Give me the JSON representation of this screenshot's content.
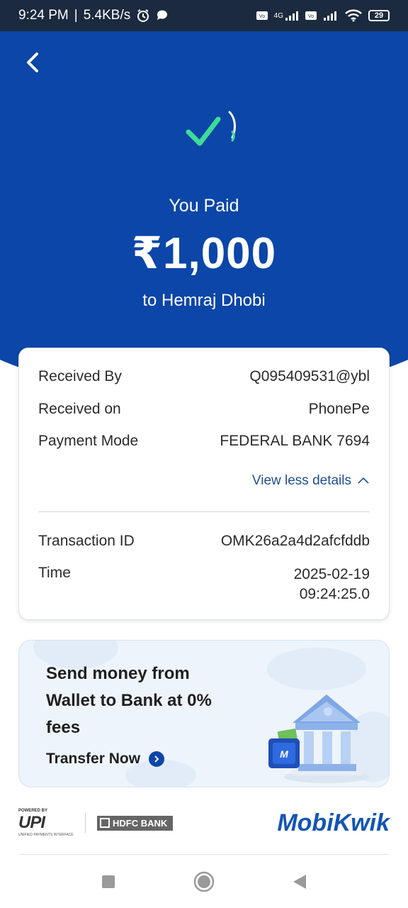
{
  "status_bar": {
    "time": "9:24 PM",
    "separator": "|",
    "speed": "5.4KB/s",
    "network_label": "4G",
    "battery": "29"
  },
  "header": {
    "back_icon": "chevron-left-icon",
    "success_icon": "check-icon",
    "title": "You Paid",
    "amount": "₹1,000",
    "payee": "to Hemraj Dhobi",
    "background_color": "#0b46a8",
    "check_color": "#3ddc97"
  },
  "details": {
    "rows": [
      {
        "label": "Received By",
        "value": "Q095409531@ybl"
      },
      {
        "label": "Received on",
        "value": "PhonePe"
      },
      {
        "label": "Payment Mode",
        "value": "FEDERAL BANK 7694"
      }
    ],
    "toggle_label": "View less details",
    "toggle_icon": "chevron-up-icon",
    "transaction_label": "Transaction ID",
    "transaction_value": "OMK26a2a4d2afcfddb",
    "time_label": "Time",
    "time_date": "2025-02-19",
    "time_clock": "09:24:25.0"
  },
  "promo": {
    "title_line1": "Send money from",
    "title_line2": "Wallet to Bank at 0%",
    "title_line3": "fees",
    "cta_label": "Transfer Now",
    "cta_icon": "chevron-right-icon",
    "art": "bank-wallet-illustration"
  },
  "footer": {
    "upi_powered": "POWERED BY",
    "upi_name": "UPI",
    "upi_tagline": "UNIFIED PAYMENTS INTERFACE",
    "bank_name": "HDFC BANK",
    "brand_name": "MobiKwik"
  },
  "nav": {
    "recents_icon": "square-icon",
    "home_icon": "circle-icon",
    "back_icon": "triangle-back-icon"
  }
}
